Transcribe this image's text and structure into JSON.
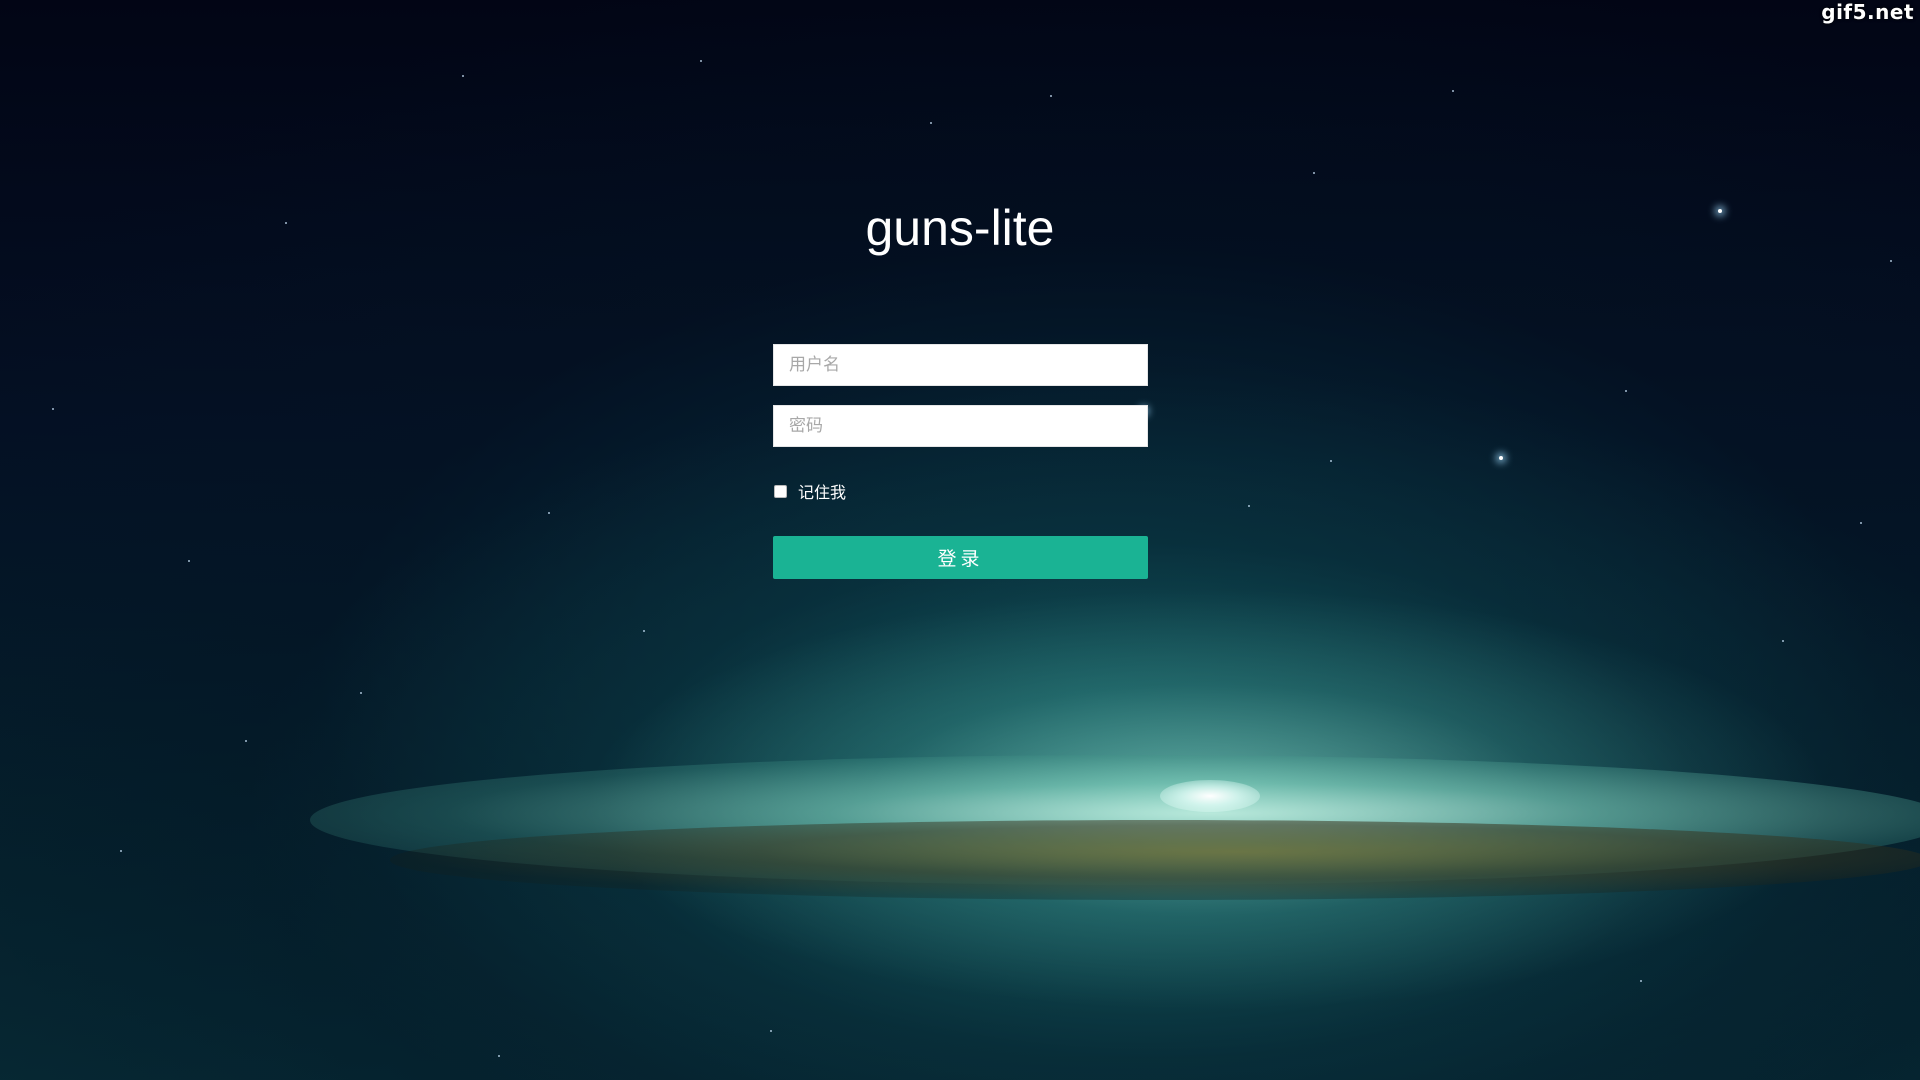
{
  "app": {
    "title": "guns-lite",
    "watermark": "gif5.net"
  },
  "login": {
    "username_placeholder": "用户名",
    "username_value": "",
    "password_placeholder": "密码",
    "password_value": "",
    "remember_label": "记住我",
    "remember_checked": false,
    "submit_label": "登录"
  },
  "colors": {
    "primary_button": "#1ab394",
    "background": "#030617"
  }
}
